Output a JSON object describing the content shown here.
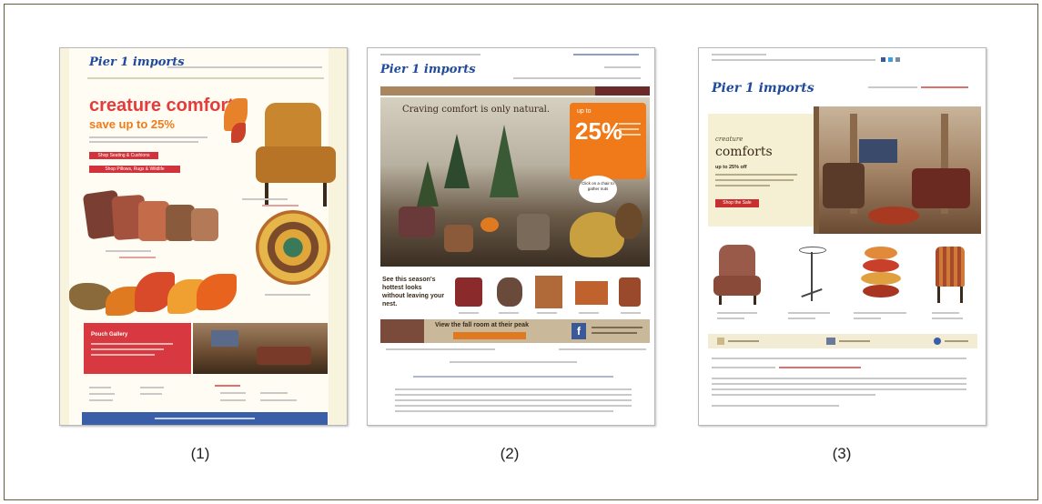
{
  "figure": {
    "captions": [
      "(1)",
      "(2)",
      "(3)"
    ]
  },
  "email1": {
    "brand": "Pier 1 imports",
    "headline": "creature comforts",
    "subhead": "save up to 25%",
    "cta1": "Shop Seating & Cushions",
    "cta2": "Shop Pillows, Rugs & Wildlife",
    "promo_title": "Pouch Gallery",
    "colors": {
      "bg": "#f7f3dc",
      "accent": "#e63b3b",
      "footer": "#3a5fa8"
    }
  },
  "email2": {
    "brand": "Pier 1 imports",
    "banner_text": "Craving comfort is only natural.",
    "badge_top": "up to",
    "badge_value": "25%",
    "bubble_text": "Click on a chair to gather nuts",
    "section_text": "See this season's hottest looks without leaving your nest.",
    "view_text": "View the fall room at their peak",
    "colors": {
      "nav": "#8b6a45",
      "badge": "#f07a1a",
      "bar": "#c9b99a"
    }
  },
  "email3": {
    "brand": "Pier 1 imports",
    "hero_small": "creature",
    "hero_big": "comforts",
    "hero_offer": "up to 25% off",
    "hero_button": "Shop the Sale",
    "colors": {
      "hero": "#f5efd3",
      "button": "#c8302f",
      "link": "#c8302f"
    }
  }
}
